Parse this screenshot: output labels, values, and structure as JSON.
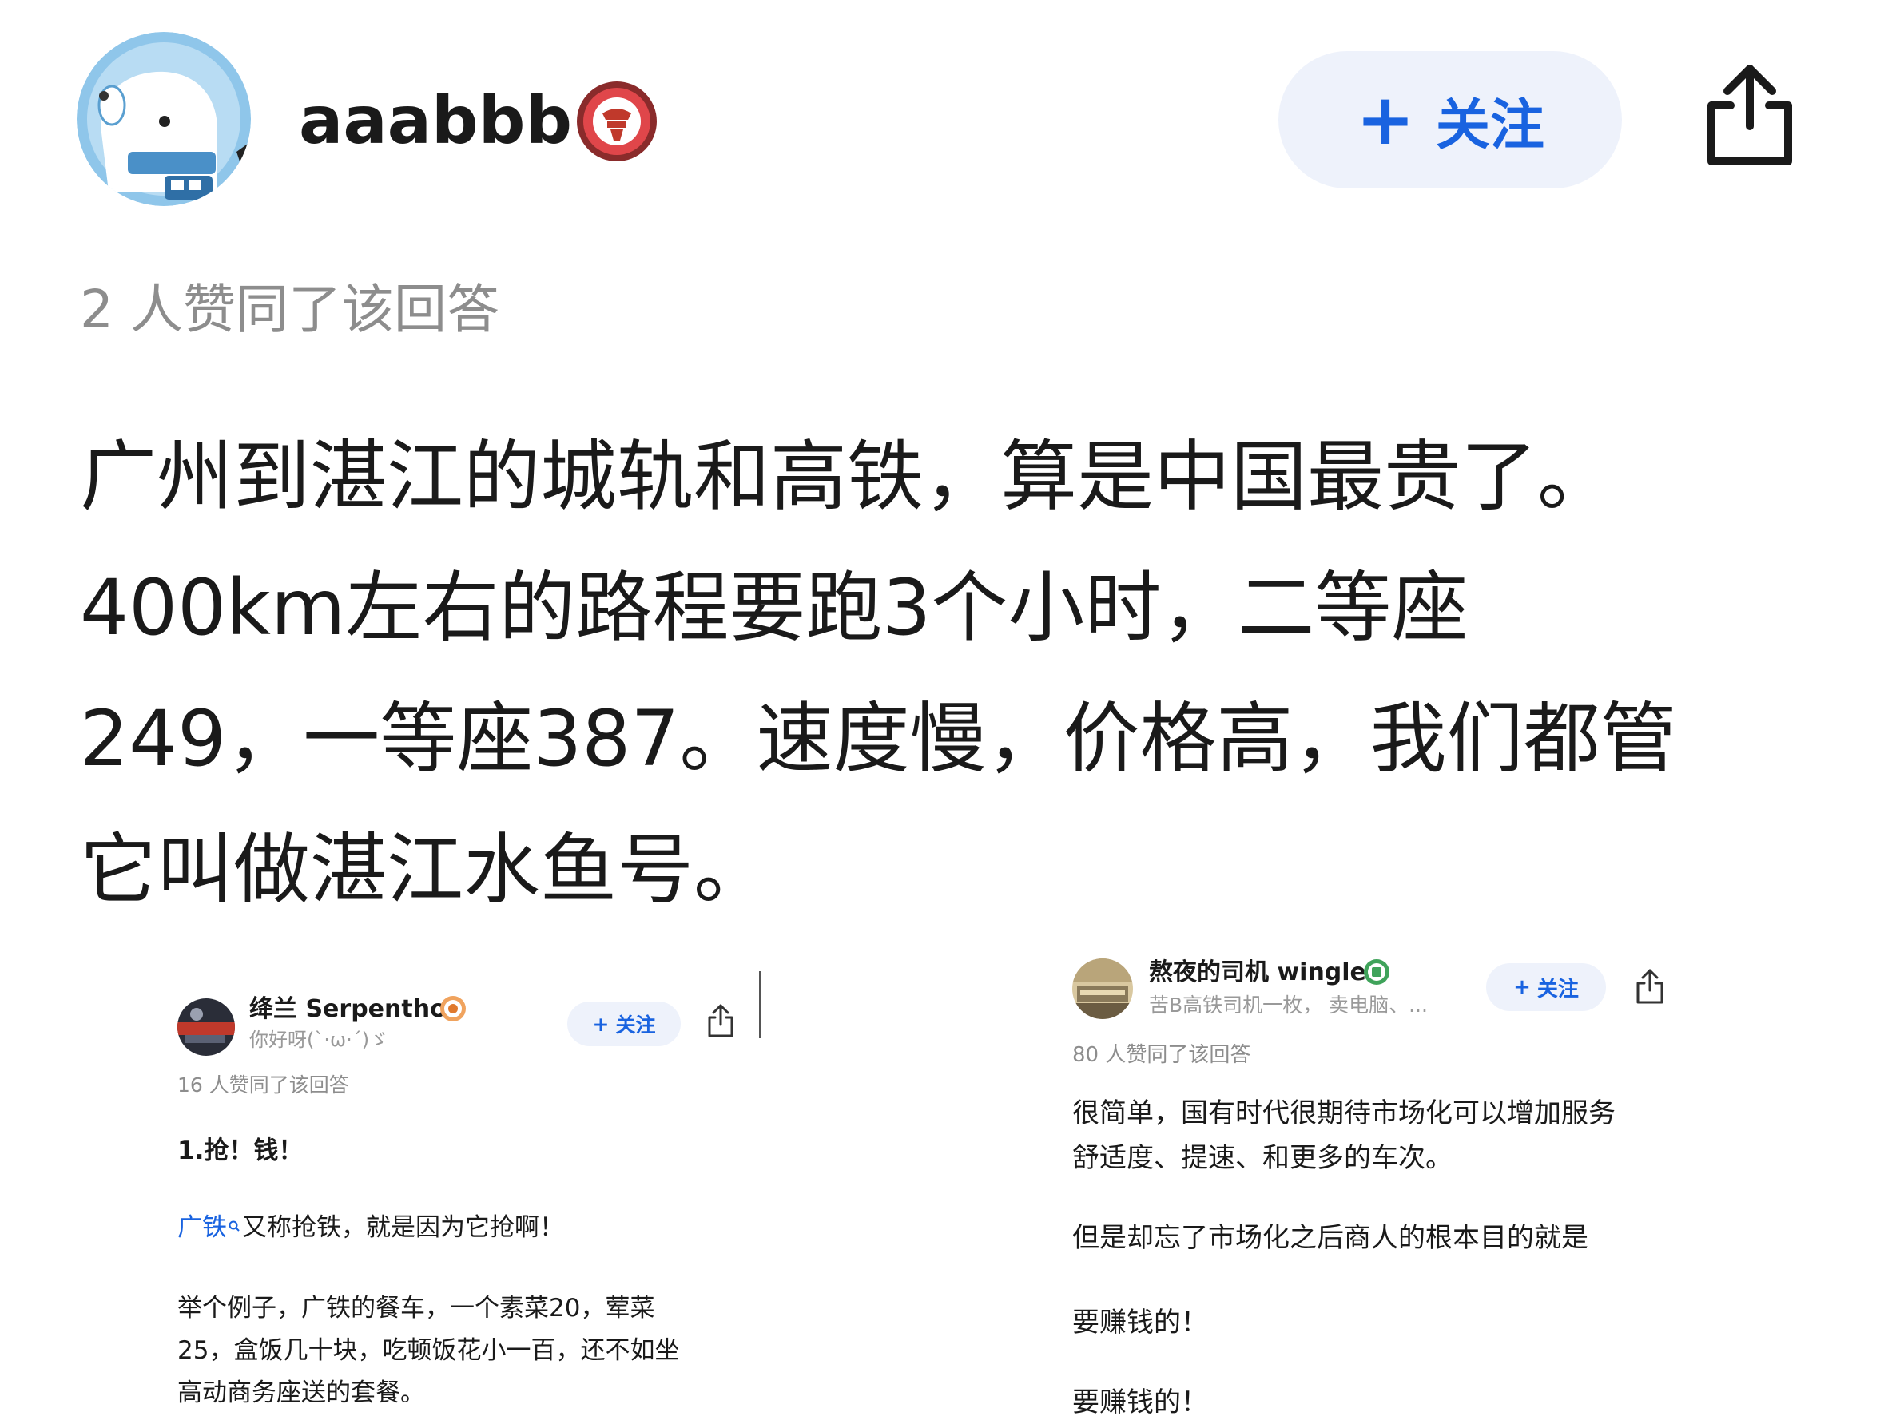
{
  "main": {
    "username": "aaabbb",
    "follow_button": {
      "plus": "+",
      "label": "关注"
    },
    "votes": "2 人赞同了该回答",
    "body_lines": [
      "广州到湛江的城轨和高铁，算是中国最贵了。",
      "400km左右的路程要跑3个小时，二等座",
      " 249，一等座387。速度慢，价格高，我们都管",
      "它叫做湛江水鱼号。"
    ],
    "badge_icon": "verified-badge-icon",
    "share_icon": "share-icon"
  },
  "left_post": {
    "username": "绛兰 Serpenthon",
    "subtitle": "你好呀(`·ω·´)ゞ",
    "follow_button": {
      "plus": "+",
      "label": "关注"
    },
    "votes": "16 人赞同了该回答",
    "heading": "1.抢！钱！",
    "p1": {
      "link": "广铁",
      "rest": "又称抢铁，就是因为它抢啊！"
    },
    "p2_lines": [
      "举个例子，广铁的餐车，一个素菜20，荤菜",
      " 25，盒饭几十块，吃顿饭花小一百，还不如坐",
      "高动商务座送的套餐。"
    ]
  },
  "right_post": {
    "username": "熬夜的司机 wingle",
    "subtitle": "苦B高铁司机一枚， 卖电脑、...",
    "follow_button": {
      "plus": "+",
      "label": "关注"
    },
    "votes": "80 人赞同了该回答",
    "p1_lines": [
      "很简单，国有时代很期待市场化可以增加服务",
      "舒适度、提速、和更多的车次。"
    ],
    "p2": "但是却忘了市场化之后商人的根本目的就是",
    "p3": "要赚钱的！",
    "p4": "要赚钱的！"
  },
  "colors": {
    "accent": "#1963e0",
    "follow_bg": "#eef2fb",
    "muted_text": "#8d8d8d",
    "body_text": "#1a1a1a"
  }
}
